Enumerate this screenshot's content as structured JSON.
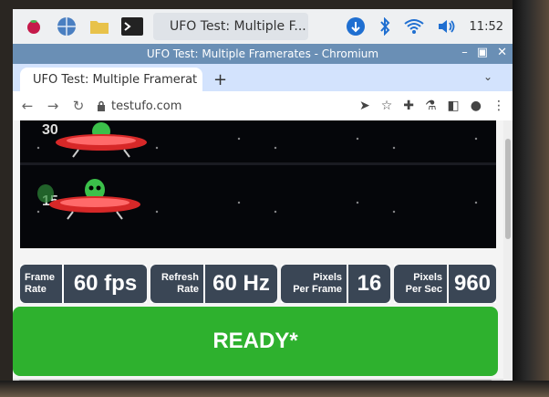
{
  "taskbar": {
    "app_title": "UFO Test: Multiple F...",
    "clock": "11:52"
  },
  "window": {
    "title": "UFO Test: Multiple Framerates - Chromium"
  },
  "tab": {
    "title": "UFO Test: Multiple Framerat",
    "close": "×",
    "new_tab": "+"
  },
  "toolbar": {
    "url": "testufo.com"
  },
  "scene": {
    "labels": [
      "30",
      "15"
    ]
  },
  "stats": [
    {
      "label_line1": "Frame",
      "label_line2": "Rate",
      "value": "60 fps"
    },
    {
      "label_line1": "Refresh",
      "label_line2": "Rate",
      "value": "60 Hz"
    },
    {
      "label_line1": "Pixels",
      "label_line2": "Per Frame",
      "value": "16"
    },
    {
      "label_line1": "Pixels",
      "label_line2": "Per Sec",
      "value": "960"
    }
  ],
  "ready_label": "READY*",
  "colors": {
    "accent_blue": "#1a73e8",
    "stat_bg": "#3a4655",
    "ready_green": "#2eb12e"
  }
}
